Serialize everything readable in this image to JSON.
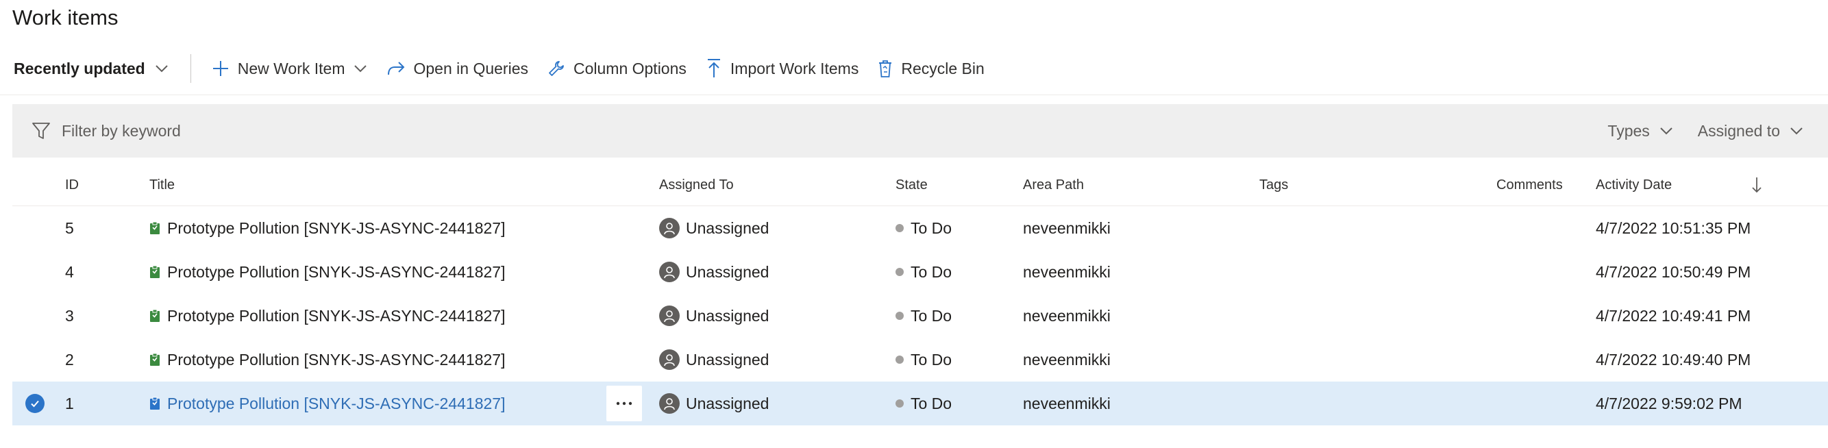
{
  "page": {
    "title": "Work items"
  },
  "toolbar": {
    "sort_label": "Recently updated",
    "new_work_item": "New Work Item",
    "open_in_queries": "Open in Queries",
    "column_options": "Column Options",
    "import_work_items": "Import Work Items",
    "recycle_bin": "Recycle Bin"
  },
  "filter": {
    "placeholder": "Filter by keyword",
    "types_label": "Types",
    "assigned_label": "Assigned to"
  },
  "columns": {
    "id": "ID",
    "title": "Title",
    "assigned_to": "Assigned To",
    "state": "State",
    "area_path": "Area Path",
    "tags": "Tags",
    "comments": "Comments",
    "activity_date": "Activity Date"
  },
  "colors": {
    "work_item_icon": "#3b8a3f",
    "selected_work_item_icon": "#2b74c8",
    "selected_row": "#deecf9",
    "state_dot": "#a19f9d",
    "link": "#2e6db5"
  },
  "rows": [
    {
      "id": "5",
      "title": "Prototype Pollution [SNYK-JS-ASYNC-2441827]",
      "assigned": "Unassigned",
      "state": "To Do",
      "area": "neveenmikki",
      "tags": "",
      "comments": "",
      "activity": "4/7/2022 10:51:35 PM",
      "selected": false
    },
    {
      "id": "4",
      "title": "Prototype Pollution [SNYK-JS-ASYNC-2441827]",
      "assigned": "Unassigned",
      "state": "To Do",
      "area": "neveenmikki",
      "tags": "",
      "comments": "",
      "activity": "4/7/2022 10:50:49 PM",
      "selected": false
    },
    {
      "id": "3",
      "title": "Prototype Pollution [SNYK-JS-ASYNC-2441827]",
      "assigned": "Unassigned",
      "state": "To Do",
      "area": "neveenmikki",
      "tags": "",
      "comments": "",
      "activity": "4/7/2022 10:49:41 PM",
      "selected": false
    },
    {
      "id": "2",
      "title": "Prototype Pollution [SNYK-JS-ASYNC-2441827]",
      "assigned": "Unassigned",
      "state": "To Do",
      "area": "neveenmikki",
      "tags": "",
      "comments": "",
      "activity": "4/7/2022 10:49:40 PM",
      "selected": false
    },
    {
      "id": "1",
      "title": "Prototype Pollution [SNYK-JS-ASYNC-2441827]",
      "assigned": "Unassigned",
      "state": "To Do",
      "area": "neveenmikki",
      "tags": "",
      "comments": "",
      "activity": "4/7/2022 9:59:02 PM",
      "selected": true
    }
  ]
}
